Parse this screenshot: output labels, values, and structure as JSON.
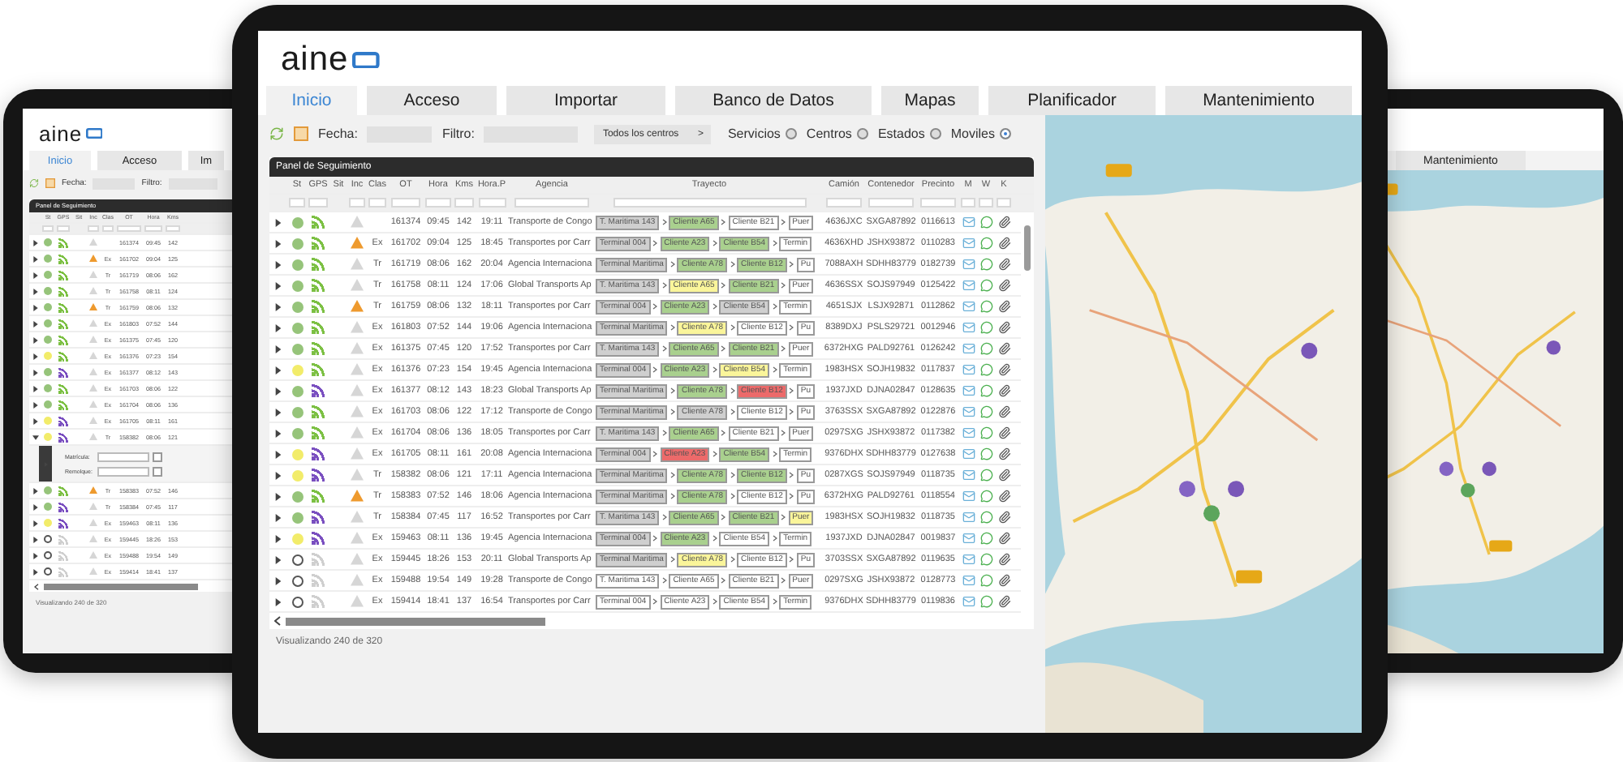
{
  "left_tablet": {
    "logo": "aine",
    "tabs": [
      {
        "label": "Inicio",
        "selected": true
      },
      {
        "label": "Acceso",
        "selected": false
      },
      {
        "label": "Im",
        "selected": false
      }
    ],
    "toolbar": {
      "fecha_label": "Fecha:",
      "filtro_label": "Filtro:"
    },
    "panel": {
      "title": "Panel de Seguimiento",
      "columns": [
        "St",
        "GPS",
        "Sit",
        "Inc",
        "Clas",
        "OT",
        "Hora",
        "Kms"
      ],
      "rows": [
        {
          "expanded": false,
          "st": {
            "kind": "dot",
            "color": "#96c47a"
          },
          "gps": {
            "color": "#7cc043"
          },
          "inc": false,
          "ot": "161374",
          "hora": "09:45",
          "kms": "142"
        },
        {
          "expanded": false,
          "st": {
            "kind": "dot",
            "color": "#96c47a"
          },
          "gps": {
            "color": "#7cc043"
          },
          "inc": true,
          "clas": "Ex",
          "ot": "161702",
          "hora": "09:04",
          "kms": "125"
        },
        {
          "expanded": false,
          "st": {
            "kind": "dot",
            "color": "#96c47a"
          },
          "gps": {
            "color": "#7cc043"
          },
          "inc": false,
          "clas": "Tr",
          "ot": "161719",
          "hora": "08:06",
          "kms": "162"
        },
        {
          "expanded": false,
          "st": {
            "kind": "dot",
            "color": "#96c47a"
          },
          "gps": {
            "color": "#7cc043"
          },
          "inc": false,
          "clas": "Tr",
          "ot": "161758",
          "hora": "08:11",
          "kms": "124"
        },
        {
          "expanded": false,
          "st": {
            "kind": "dot",
            "color": "#96c47a"
          },
          "gps": {
            "color": "#7cc043"
          },
          "inc": true,
          "clas": "Tr",
          "ot": "161759",
          "hora": "08:06",
          "kms": "132"
        },
        {
          "expanded": false,
          "st": {
            "kind": "dot",
            "color": "#96c47a"
          },
          "gps": {
            "color": "#7cc043"
          },
          "inc": false,
          "clas": "Ex",
          "ot": "161803",
          "hora": "07:52",
          "kms": "144"
        },
        {
          "expanded": false,
          "st": {
            "kind": "dot",
            "color": "#96c47a"
          },
          "gps": {
            "color": "#7cc043"
          },
          "inc": false,
          "clas": "Ex",
          "ot": "161375",
          "hora": "07:45",
          "kms": "120"
        },
        {
          "expanded": false,
          "st": {
            "kind": "dot",
            "color": "#f2ec6a"
          },
          "gps": {
            "color": "#7cc043"
          },
          "inc": false,
          "clas": "Ex",
          "ot": "161376",
          "hora": "07:23",
          "kms": "154"
        },
        {
          "expanded": false,
          "st": {
            "kind": "dot",
            "color": "#96c47a"
          },
          "gps": {
            "color": "#7a4fc0"
          },
          "inc": false,
          "clas": "Ex",
          "ot": "161377",
          "hora": "08:12",
          "kms": "143"
        },
        {
          "expanded": false,
          "st": {
            "kind": "dot",
            "color": "#96c47a"
          },
          "gps": {
            "color": "#7cc043"
          },
          "inc": false,
          "clas": "Ex",
          "ot": "161703",
          "hora": "08:06",
          "kms": "122"
        },
        {
          "expanded": false,
          "st": {
            "kind": "dot",
            "color": "#96c47a"
          },
          "gps": {
            "color": "#7cc043"
          },
          "inc": false,
          "clas": "Ex",
          "ot": "161704",
          "hora": "08:06",
          "kms": "136"
        },
        {
          "expanded": false,
          "st": {
            "kind": "dot",
            "color": "#f2ec6a"
          },
          "gps": {
            "color": "#7a4fc0"
          },
          "inc": false,
          "clas": "Ex",
          "ot": "161705",
          "hora": "08:11",
          "kms": "161"
        },
        {
          "expanded": true,
          "st": {
            "kind": "dot",
            "color": "#f2ec6a"
          },
          "gps": {
            "color": "#7a4fc0"
          },
          "inc": false,
          "clas": "Tr",
          "ot": "158382",
          "hora": "08:06",
          "kms": "121",
          "details": [
            {
              "label": "Matrícula:",
              "checked": false
            },
            {
              "label": "Remolque:",
              "checked": false
            }
          ]
        },
        {
          "expanded": false,
          "st": {
            "kind": "dot",
            "color": "#96c47a"
          },
          "gps": {
            "color": "#7cc043"
          },
          "inc": true,
          "clas": "Tr",
          "ot": "158383",
          "hora": "07:52",
          "kms": "146"
        },
        {
          "expanded": false,
          "st": {
            "kind": "dot",
            "color": "#96c47a"
          },
          "gps": {
            "color": "#7a4fc0"
          },
          "inc": false,
          "clas": "Tr",
          "ot": "158384",
          "hora": "07:45",
          "kms": "117"
        },
        {
          "expanded": false,
          "st": {
            "kind": "dot",
            "color": "#f2ec6a"
          },
          "gps": {
            "color": "#7a4fc0"
          },
          "inc": false,
          "clas": "Ex",
          "ot": "159463",
          "hora": "08:11",
          "kms": "136"
        },
        {
          "expanded": false,
          "st": {
            "kind": "ring",
            "color": "#555555"
          },
          "gps": {
            "color": "#cfcfcf"
          },
          "inc": false,
          "clas": "Ex",
          "ot": "159445",
          "hora": "18:26",
          "kms": "153"
        },
        {
          "expanded": false,
          "st": {
            "kind": "ring",
            "color": "#555555"
          },
          "gps": {
            "color": "#cfcfcf"
          },
          "inc": false,
          "clas": "Ex",
          "ot": "159488",
          "hora": "19:54",
          "kms": "149"
        },
        {
          "expanded": false,
          "st": {
            "kind": "ring",
            "color": "#555555"
          },
          "gps": {
            "color": "#cfcfcf"
          },
          "inc": false,
          "clas": "Ex",
          "ot": "159414",
          "hora": "18:41",
          "kms": "137"
        }
      ],
      "footer": "Visualizando 240 de 320"
    }
  },
  "main_tablet": {
    "logo": "aine",
    "tabs": [
      {
        "label": "Inicio",
        "selected": true
      },
      {
        "label": "Acceso",
        "selected": false
      },
      {
        "label": "Importar",
        "selected": false
      },
      {
        "label": "Banco de Datos",
        "selected": false
      },
      {
        "label": "Mapas",
        "selected": false
      },
      {
        "label": "Planificador",
        "selected": false
      },
      {
        "label": "Mantenimiento",
        "selected": false
      }
    ],
    "toolbar": {
      "fecha_label": "Fecha:",
      "filtro_label": "Filtro:",
      "centers_button": "Todos los centros",
      "centers_caret": ">",
      "radios": [
        {
          "label": "Servicios",
          "selected": false
        },
        {
          "label": "Centros",
          "selected": false
        },
        {
          "label": "Estados",
          "selected": false
        },
        {
          "label": "Moviles",
          "selected": true
        }
      ]
    },
    "panel": {
      "title": "Panel de Seguimiento",
      "columns": [
        "St",
        "GPS",
        "Sit",
        "Inc",
        "Clas",
        "OT",
        "Hora",
        "Kms",
        "Hora.P",
        "Agencia",
        "Trayecto",
        "Camión",
        "Contenedor",
        "Precinto",
        "M",
        "W",
        "K"
      ],
      "rows": [
        {
          "st": {
            "kind": "dot",
            "color": "#96c47a"
          },
          "gps": {
            "color": "#7cc043"
          },
          "inc": false,
          "ot": "161374",
          "hora": "09:45",
          "kms": "142",
          "hora_p": "19:11",
          "agencia": "Transporte de Congo",
          "route": [
            {
              "text": "T. Maritima 143",
              "color": "#cfcfcf"
            },
            {
              "text": "Cliente A65",
              "color": "#a9d08e"
            },
            {
              "text": "Cliente B21",
              "color": "#ffffff"
            },
            {
              "text": "Puer",
              "color": "#ffffff"
            }
          ],
          "camion": "4636JXC",
          "contenedor": "SXGA87892",
          "precinto": "0116613"
        },
        {
          "st": {
            "kind": "dot",
            "color": "#96c47a"
          },
          "gps": {
            "color": "#7cc043"
          },
          "inc": true,
          "clas": "Ex",
          "ot": "161702",
          "hora": "09:04",
          "kms": "125",
          "hora_p": "18:45",
          "agencia": "Transportes por Carr",
          "route": [
            {
              "text": "Terminal 004",
              "color": "#cfcfcf"
            },
            {
              "text": "Cliente A23",
              "color": "#a9d08e"
            },
            {
              "text": "Cliente B54",
              "color": "#a9d08e"
            },
            {
              "text": "Termin",
              "color": "#ffffff"
            }
          ],
          "camion": "4636XHD",
          "contenedor": "JSHX93872",
          "precinto": "0110283"
        },
        {
          "st": {
            "kind": "dot",
            "color": "#96c47a"
          },
          "gps": {
            "color": "#7cc043"
          },
          "inc": false,
          "clas": "Tr",
          "ot": "161719",
          "hora": "08:06",
          "kms": "162",
          "hora_p": "20:04",
          "agencia": "Agencia Internaciona",
          "route": [
            {
              "text": "Terminal Maritima",
              "color": "#cfcfcf"
            },
            {
              "text": "Cliente A78",
              "color": "#a9d08e"
            },
            {
              "text": "Cliente B12",
              "color": "#a9d08e"
            },
            {
              "text": "Pu",
              "color": "#ffffff"
            }
          ],
          "camion": "7088AXH",
          "contenedor": "SDHH83779",
          "precinto": "0182739"
        },
        {
          "st": {
            "kind": "dot",
            "color": "#96c47a"
          },
          "gps": {
            "color": "#7cc043"
          },
          "inc": false,
          "clas": "Tr",
          "ot": "161758",
          "hora": "08:11",
          "kms": "124",
          "hora_p": "17:06",
          "agencia": "Global Transports Ap",
          "route": [
            {
              "text": "T. Maritima 143",
              "color": "#cfcfcf"
            },
            {
              "text": "Cliente A65",
              "color": "#faf59a"
            },
            {
              "text": "Cliente B21",
              "color": "#a9d08e"
            },
            {
              "text": "Puer",
              "color": "#ffffff"
            }
          ],
          "camion": "4636SSX",
          "contenedor": "SOJS97949",
          "precinto": "0125422"
        },
        {
          "st": {
            "kind": "dot",
            "color": "#96c47a"
          },
          "gps": {
            "color": "#7cc043"
          },
          "inc": true,
          "clas": "Tr",
          "ot": "161759",
          "hora": "08:06",
          "kms": "132",
          "hora_p": "18:11",
          "agencia": "Transportes por Carr",
          "route": [
            {
              "text": "Terminal 004",
              "color": "#cfcfcf"
            },
            {
              "text": "Cliente A23",
              "color": "#a9d08e"
            },
            {
              "text": "Cliente B54",
              "color": "#cfcfcf"
            },
            {
              "text": "Termin",
              "color": "#ffffff"
            }
          ],
          "camion": "4651SJX",
          "contenedor": "LSJX92871",
          "precinto": "0112862"
        },
        {
          "st": {
            "kind": "dot",
            "color": "#96c47a"
          },
          "gps": {
            "color": "#7cc043"
          },
          "inc": false,
          "clas": "Ex",
          "ot": "161803",
          "hora": "07:52",
          "kms": "144",
          "hora_p": "19:06",
          "agencia": "Agencia Internaciona",
          "route": [
            {
              "text": "Terminal Maritima",
              "color": "#cfcfcf"
            },
            {
              "text": "Cliente A78",
              "color": "#faf59a"
            },
            {
              "text": "Cliente B12",
              "color": "#ffffff"
            },
            {
              "text": "Pu",
              "color": "#ffffff"
            }
          ],
          "camion": "8389DXJ",
          "contenedor": "PSLS29721",
          "precinto": "0012946"
        },
        {
          "st": {
            "kind": "dot",
            "color": "#96c47a"
          },
          "gps": {
            "color": "#7cc043"
          },
          "inc": false,
          "clas": "Ex",
          "ot": "161375",
          "hora": "07:45",
          "kms": "120",
          "hora_p": "17:52",
          "agencia": "Transportes por Carr",
          "route": [
            {
              "text": "T. Maritima 143",
              "color": "#cfcfcf"
            },
            {
              "text": "Cliente A65",
              "color": "#a9d08e"
            },
            {
              "text": "Cliente B21",
              "color": "#a9d08e"
            },
            {
              "text": "Puer",
              "color": "#ffffff"
            }
          ],
          "camion": "6372HXG",
          "contenedor": "PALD92761",
          "precinto": "0126242"
        },
        {
          "st": {
            "kind": "dot",
            "color": "#f2ec6a"
          },
          "gps": {
            "color": "#7cc043"
          },
          "inc": false,
          "clas": "Ex",
          "ot": "161376",
          "hora": "07:23",
          "kms": "154",
          "hora_p": "19:45",
          "agencia": "Agencia Internaciona",
          "route": [
            {
              "text": "Terminal 004",
              "color": "#cfcfcf"
            },
            {
              "text": "Cliente A23",
              "color": "#a9d08e"
            },
            {
              "text": "Cliente B54",
              "color": "#faf59a"
            },
            {
              "text": "Termin",
              "color": "#ffffff"
            }
          ],
          "camion": "1983HSX",
          "contenedor": "SOJH19832",
          "precinto": "0117837"
        },
        {
          "st": {
            "kind": "dot",
            "color": "#96c47a"
          },
          "gps": {
            "color": "#7a4fc0"
          },
          "inc": false,
          "clas": "Ex",
          "ot": "161377",
          "hora": "08:12",
          "kms": "143",
          "hora_p": "18:23",
          "agencia": "Global Transports Ap",
          "route": [
            {
              "text": "Terminal Maritima",
              "color": "#cfcfcf"
            },
            {
              "text": "Cliente A78",
              "color": "#a9d08e"
            },
            {
              "text": "Cliente B12",
              "color": "#ec6a6a"
            },
            {
              "text": "Pu",
              "color": "#ffffff"
            }
          ],
          "camion": "1937JXD",
          "contenedor": "DJNA02847",
          "precinto": "0128635"
        },
        {
          "st": {
            "kind": "dot",
            "color": "#96c47a"
          },
          "gps": {
            "color": "#7cc043"
          },
          "inc": false,
          "clas": "Ex",
          "ot": "161703",
          "hora": "08:06",
          "kms": "122",
          "hora_p": "17:12",
          "agencia": "Transporte de Congo",
          "route": [
            {
              "text": "Terminal Maritima",
              "color": "#cfcfcf"
            },
            {
              "text": "Cliente A78",
              "color": "#cfcfcf"
            },
            {
              "text": "Cliente B12",
              "color": "#ffffff"
            },
            {
              "text": "Pu",
              "color": "#ffffff"
            }
          ],
          "camion": "3763SSX",
          "contenedor": "SXGA87892",
          "precinto": "0122876"
        },
        {
          "st": {
            "kind": "dot",
            "color": "#96c47a"
          },
          "gps": {
            "color": "#7cc043"
          },
          "inc": false,
          "clas": "Ex",
          "ot": "161704",
          "hora": "08:06",
          "kms": "136",
          "hora_p": "18:05",
          "agencia": "Transportes por Carr",
          "route": [
            {
              "text": "T. Maritima 143",
              "color": "#cfcfcf"
            },
            {
              "text": "Cliente A65",
              "color": "#a9d08e"
            },
            {
              "text": "Cliente B21",
              "color": "#ffffff"
            },
            {
              "text": "Puer",
              "color": "#ffffff"
            }
          ],
          "camion": "0297SXG",
          "contenedor": "JSHX93872",
          "precinto": "0117382"
        },
        {
          "st": {
            "kind": "dot",
            "color": "#f2ec6a"
          },
          "gps": {
            "color": "#7a4fc0"
          },
          "inc": false,
          "clas": "Ex",
          "ot": "161705",
          "hora": "08:11",
          "kms": "161",
          "hora_p": "20:08",
          "agencia": "Agencia Internaciona",
          "route": [
            {
              "text": "Terminal 004",
              "color": "#cfcfcf"
            },
            {
              "text": "Cliente A23",
              "color": "#ec6a6a"
            },
            {
              "text": "Cliente B54",
              "color": "#a9d08e"
            },
            {
              "text": "Termin",
              "color": "#ffffff"
            }
          ],
          "camion": "9376DHX",
          "contenedor": "SDHH83779",
          "precinto": "0127638"
        },
        {
          "st": {
            "kind": "dot",
            "color": "#f2ec6a"
          },
          "gps": {
            "color": "#7a4fc0"
          },
          "inc": false,
          "clas": "Tr",
          "ot": "158382",
          "hora": "08:06",
          "kms": "121",
          "hora_p": "17:11",
          "agencia": "Agencia Internaciona",
          "route": [
            {
              "text": "Terminal Maritima",
              "color": "#cfcfcf"
            },
            {
              "text": "Cliente A78",
              "color": "#a9d08e"
            },
            {
              "text": "Cliente B12",
              "color": "#a9d08e"
            },
            {
              "text": "Pu",
              "color": "#ffffff"
            }
          ],
          "camion": "0287XGS",
          "contenedor": "SOJS97949",
          "precinto": "0118735"
        },
        {
          "st": {
            "kind": "dot",
            "color": "#96c47a"
          },
          "gps": {
            "color": "#7cc043"
          },
          "inc": true,
          "clas": "Tr",
          "ot": "158383",
          "hora": "07:52",
          "kms": "146",
          "hora_p": "18:06",
          "agencia": "Agencia Internaciona",
          "route": [
            {
              "text": "Terminal Maritima",
              "color": "#cfcfcf"
            },
            {
              "text": "Cliente A78",
              "color": "#a9d08e"
            },
            {
              "text": "Cliente B12",
              "color": "#ffffff"
            },
            {
              "text": "Pu",
              "color": "#ffffff"
            }
          ],
          "camion": "6372HXG",
          "contenedor": "PALD92761",
          "precinto": "0118554"
        },
        {
          "st": {
            "kind": "dot",
            "color": "#96c47a"
          },
          "gps": {
            "color": "#7a4fc0"
          },
          "inc": false,
          "clas": "Tr",
          "ot": "158384",
          "hora": "07:45",
          "kms": "117",
          "hora_p": "16:52",
          "agencia": "Transportes por Carr",
          "route": [
            {
              "text": "T. Maritima 143",
              "color": "#cfcfcf"
            },
            {
              "text": "Cliente A65",
              "color": "#a9d08e"
            },
            {
              "text": "Cliente B21",
              "color": "#a9d08e"
            },
            {
              "text": "Puer",
              "color": "#faf59a"
            }
          ],
          "camion": "1983HSX",
          "contenedor": "SOJH19832",
          "precinto": "0118735"
        },
        {
          "st": {
            "kind": "dot",
            "color": "#f2ec6a"
          },
          "gps": {
            "color": "#7a4fc0"
          },
          "inc": false,
          "clas": "Ex",
          "ot": "159463",
          "hora": "08:11",
          "kms": "136",
          "hora_p": "19:45",
          "agencia": "Agencia Internaciona",
          "route": [
            {
              "text": "Terminal 004",
              "color": "#cfcfcf"
            },
            {
              "text": "Cliente A23",
              "color": "#a9d08e"
            },
            {
              "text": "Cliente B54",
              "color": "#ffffff"
            },
            {
              "text": "Termin",
              "color": "#ffffff"
            }
          ],
          "camion": "1937JXD",
          "contenedor": "DJNA02847",
          "precinto": "0019837"
        },
        {
          "st": {
            "kind": "ring",
            "color": "#555555"
          },
          "gps": {
            "color": "#cfcfcf"
          },
          "inc": false,
          "clas": "Ex",
          "ot": "159445",
          "hora": "18:26",
          "kms": "153",
          "hora_p": "20:11",
          "agencia": "Global Transports Ap",
          "route": [
            {
              "text": "Terminal Maritima",
              "color": "#cfcfcf"
            },
            {
              "text": "Cliente A78",
              "color": "#faf59a"
            },
            {
              "text": "Cliente B12",
              "color": "#ffffff"
            },
            {
              "text": "Pu",
              "color": "#ffffff"
            }
          ],
          "camion": "3703SSX",
          "contenedor": "SXGA87892",
          "precinto": "0119635"
        },
        {
          "st": {
            "kind": "ring",
            "color": "#555555"
          },
          "gps": {
            "color": "#cfcfcf"
          },
          "inc": false,
          "clas": "Ex",
          "ot": "159488",
          "hora": "19:54",
          "kms": "149",
          "hora_p": "19:28",
          "agencia": "Transporte de Congo",
          "route": [
            {
              "text": "T. Maritima 143",
              "color": "#ffffff"
            },
            {
              "text": "Cliente A65",
              "color": "#ffffff"
            },
            {
              "text": "Cliente B21",
              "color": "#ffffff"
            },
            {
              "text": "Puer",
              "color": "#ffffff"
            }
          ],
          "camion": "0297SXG",
          "contenedor": "JSHX93872",
          "precinto": "0128773"
        },
        {
          "st": {
            "kind": "ring",
            "color": "#555555"
          },
          "gps": {
            "color": "#cfcfcf"
          },
          "inc": false,
          "clas": "Ex",
          "ot": "159414",
          "hora": "18:41",
          "kms": "137",
          "hora_p": "16:54",
          "agencia": "Transportes por Carr",
          "route": [
            {
              "text": "Terminal 004",
              "color": "#ffffff"
            },
            {
              "text": "Cliente A23",
              "color": "#ffffff"
            },
            {
              "text": "Cliente B54",
              "color": "#ffffff"
            },
            {
              "text": "Termin",
              "color": "#ffffff"
            }
          ],
          "camion": "9376DHX",
          "contenedor": "SDHH83779",
          "precinto": "0119836"
        }
      ],
      "footer": "Visualizando 240 de 320"
    }
  },
  "right_tablet": {
    "tabs": [
      {
        "label": "Mantenimiento",
        "selected": false
      }
    ]
  }
}
